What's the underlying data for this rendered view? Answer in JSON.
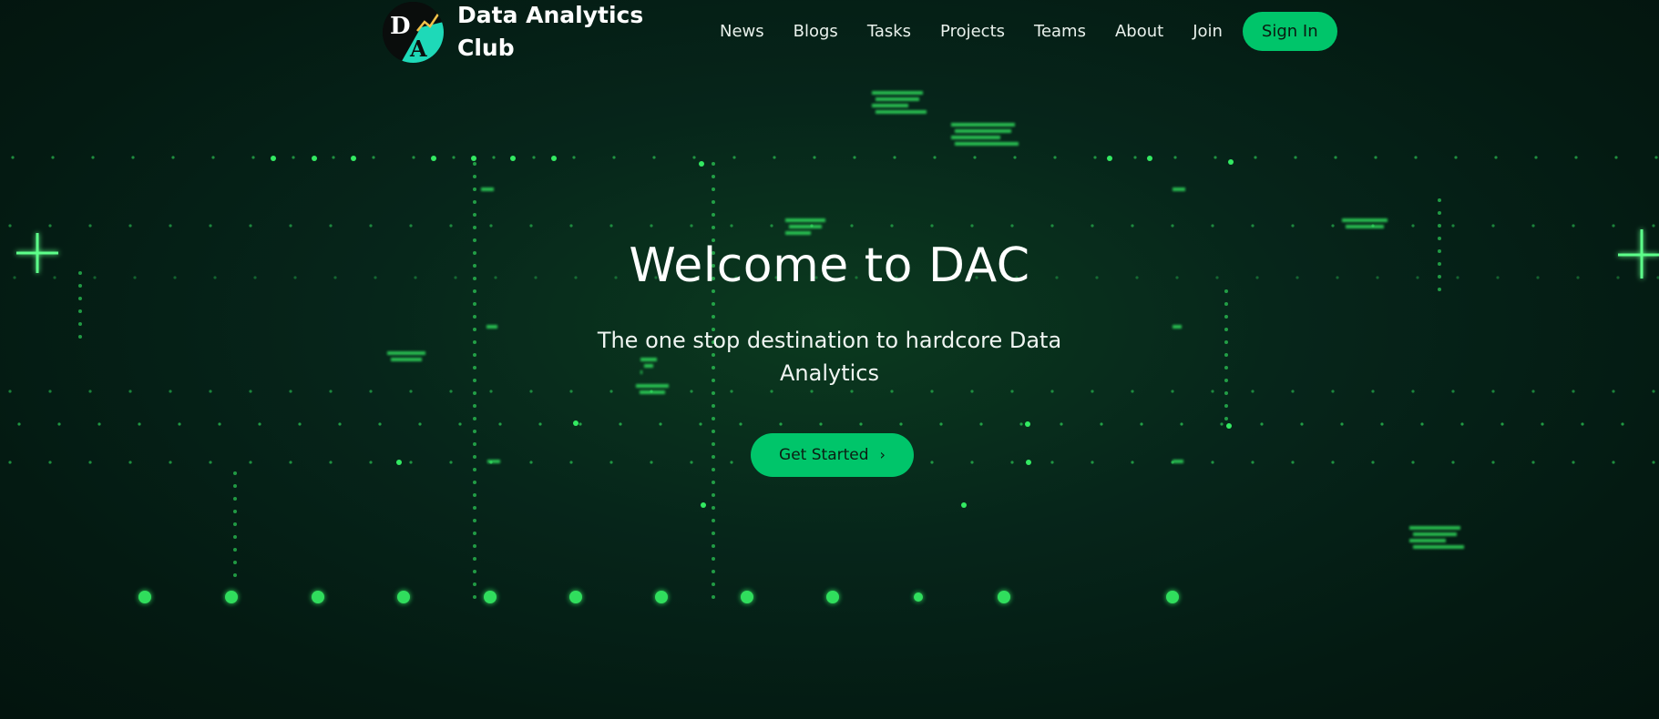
{
  "brand": {
    "name": "Data Analytics Club",
    "logo_letters": [
      "D",
      "A"
    ],
    "logo_icon": "trend-chart-icon"
  },
  "nav": {
    "links": [
      "News",
      "Blogs",
      "Tasks",
      "Projects",
      "Teams",
      "About",
      "Join"
    ],
    "signin_label": "Sign In"
  },
  "hero": {
    "title": "Welcome to DAC",
    "subtitle": "The one stop destination to hardcore Data Analytics",
    "cta_label": "Get Started",
    "cta_icon": "chevron-right-icon"
  },
  "colors": {
    "accent": "#00c56a",
    "glow": "#39ff6a",
    "background": "#041a12",
    "logo_teal": "#1ed9b8"
  }
}
